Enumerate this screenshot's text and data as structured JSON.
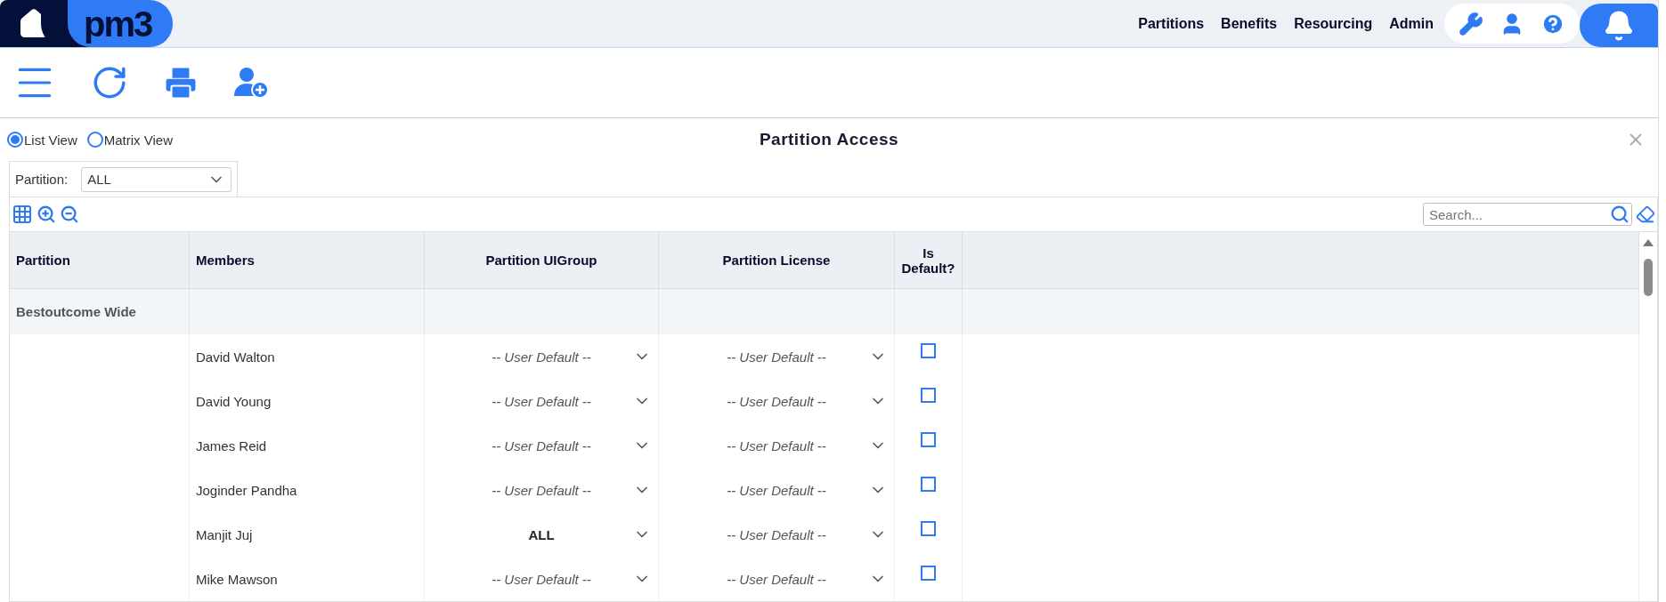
{
  "header": {
    "logo": "pm3",
    "nav": [
      "Partitions",
      "Benefits",
      "Resourcing",
      "Admin"
    ]
  },
  "view_options": [
    {
      "label": "List View",
      "selected": true
    },
    {
      "label": "Matrix View",
      "selected": false
    }
  ],
  "panel": {
    "title": "Partition Access"
  },
  "filter": {
    "label": "Partition:",
    "value": "ALL"
  },
  "search": {
    "placeholder": "Search..."
  },
  "table": {
    "columns": [
      "Partition",
      "Members",
      "Partition UIGroup",
      "Partition License",
      "Is Default?"
    ],
    "groups": [
      {
        "partition": "Bestoutcome Wide",
        "members": [
          {
            "name": "David Walton",
            "ui_group": {
              "text": "-- User Default --",
              "kind": "default"
            },
            "license": {
              "text": "-- User Default --",
              "kind": "default"
            },
            "checked": false
          },
          {
            "name": "David Young",
            "ui_group": {
              "text": "-- User Default --",
              "kind": "default"
            },
            "license": {
              "text": "-- User Default --",
              "kind": "default"
            },
            "checked": false
          },
          {
            "name": "James Reid",
            "ui_group": {
              "text": "-- User Default --",
              "kind": "default"
            },
            "license": {
              "text": "-- User Default --",
              "kind": "default"
            },
            "checked": false
          },
          {
            "name": "Joginder Pandha",
            "ui_group": {
              "text": "-- User Default --",
              "kind": "default"
            },
            "license": {
              "text": "-- User Default --",
              "kind": "default"
            },
            "checked": false
          },
          {
            "name": "Manjit Juj",
            "ui_group": {
              "text": "ALL",
              "kind": "value"
            },
            "license": {
              "text": "-- User Default --",
              "kind": "default"
            },
            "checked": false
          },
          {
            "name": "Mike Mawson",
            "ui_group": {
              "text": "-- User Default --",
              "kind": "default"
            },
            "license": {
              "text": "-- User Default --",
              "kind": "default"
            },
            "checked": false
          }
        ]
      }
    ]
  }
}
